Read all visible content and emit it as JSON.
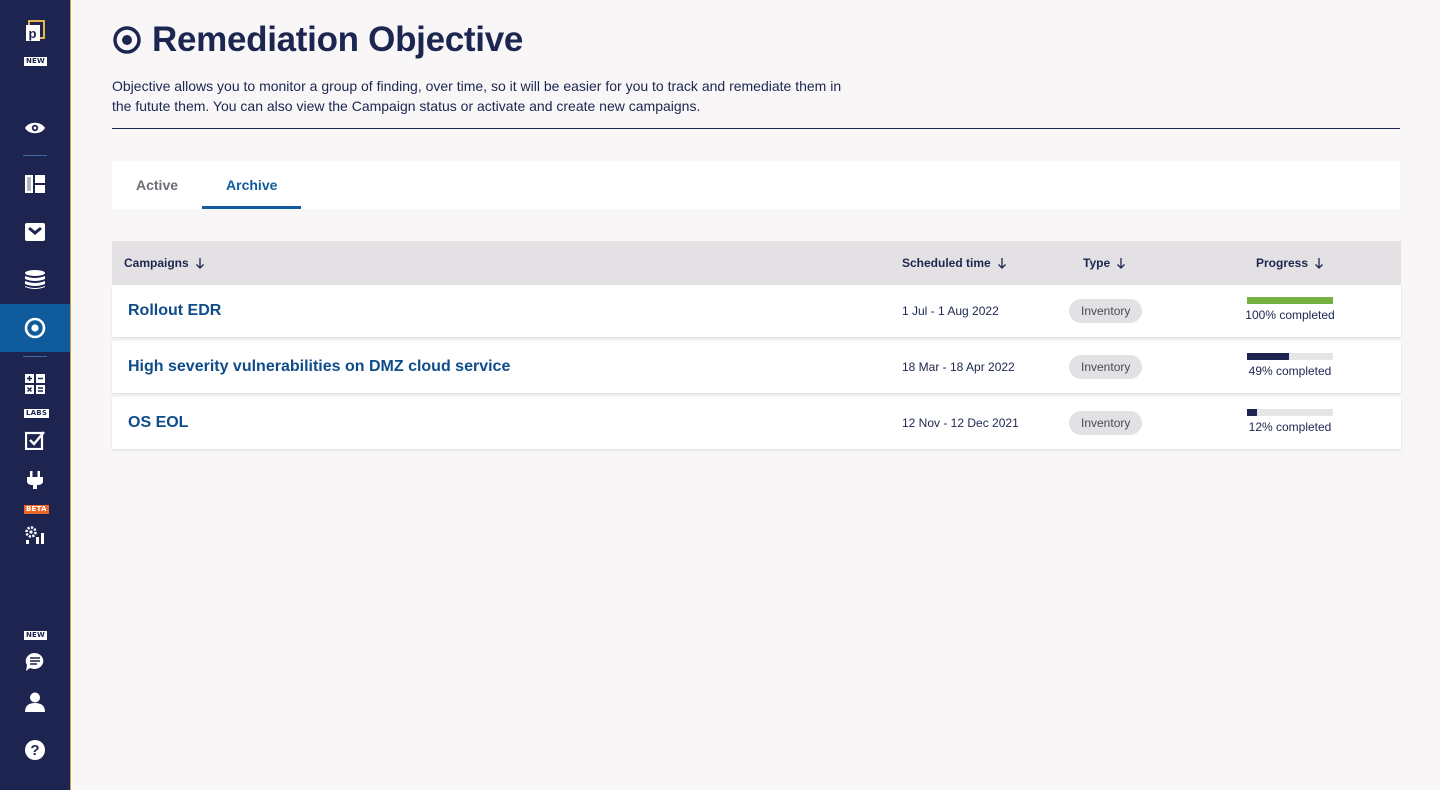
{
  "sidebar": {
    "tags": {
      "new_top": "NEW",
      "labs": "LABS",
      "beta": "BETA",
      "new_bottom": "NEW"
    },
    "active_item": "objectives"
  },
  "page": {
    "title": "Remediation Objective",
    "description": "Objective allows you to monitor a group of finding, over time, so it will be easier for you to track and remediate them in the futute them. You can also view the Campaign status or activate and create new campaigns."
  },
  "tabs": [
    {
      "label": "Active",
      "selected": false
    },
    {
      "label": "Archive",
      "selected": true
    }
  ],
  "table": {
    "headers": {
      "campaigns": "Campaigns",
      "scheduled_time": "Scheduled time",
      "type": "Type",
      "progress": "Progress"
    },
    "rows": [
      {
        "name": "Rollout EDR",
        "scheduled": "1 Jul - 1 Aug 2022",
        "type": "Inventory",
        "progress": 100,
        "progress_text": "100% completed"
      },
      {
        "name": "High severity vulnerabilities on DMZ cloud service",
        "scheduled": "18 Mar - 18 Apr 2022",
        "type": "Inventory",
        "progress": 49,
        "progress_text": "49% completed"
      },
      {
        "name": "OS EOL",
        "scheduled": "12 Nov - 12 Dec 2021",
        "type": "Inventory",
        "progress": 12,
        "progress_text": "12% completed"
      }
    ]
  },
  "colors": {
    "sidebar_bg": "#1d2450",
    "active_nav": "#0f5b9c",
    "link": "#0f4c8a",
    "progress_complete": "#76b041",
    "progress_partial": "#1d2450"
  }
}
